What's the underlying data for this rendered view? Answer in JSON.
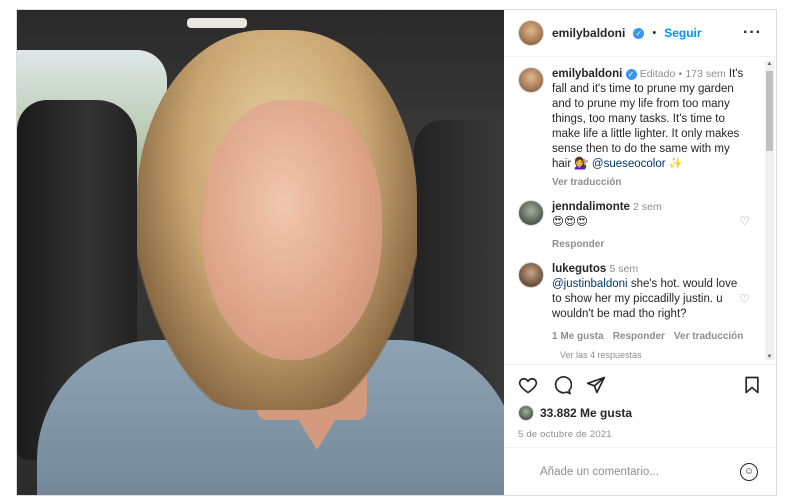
{
  "header": {
    "username": "emilybaldoni",
    "separator": "•",
    "follow_label": "Seguir",
    "more_icon": "more-horizontal-icon"
  },
  "caption": {
    "username": "emilybaldoni",
    "edited": "Editado",
    "separator": "•",
    "age": "173 sem",
    "text": "It's fall and it's time to prune my garden and to prune my life from too many things, too many tasks. It's time to make life a little lighter. It only makes sense then to do the same with my hair 💇‍♀️",
    "mention": "@sueseocolor",
    "trailing_emoji": "✨",
    "translate": "Ver traducción"
  },
  "comments": [
    {
      "username": "jenndalimonte",
      "age": "2 sem",
      "text": "😍😍😍",
      "reply": "Responder"
    },
    {
      "username": "lukegutos",
      "age": "5 sem",
      "mention": "@justinbaldoni",
      "text": "she's hot. would love to show her my piccadilly justin. u wouldn't be mad tho right?",
      "likes": "1 Me gusta",
      "reply": "Responder",
      "translate": "Ver traducción"
    }
  ],
  "view_replies": "Ver las 4 respuestas",
  "actions": {
    "like_icon": "heart-icon",
    "comment_icon": "comment-icon",
    "share_icon": "share-icon",
    "save_icon": "bookmark-icon"
  },
  "likes": {
    "count_text": "33.882 Me gusta"
  },
  "date": "5 de octubre de 2021",
  "add_comment": {
    "placeholder": "Añade un comentario...",
    "emoji": "☺"
  }
}
